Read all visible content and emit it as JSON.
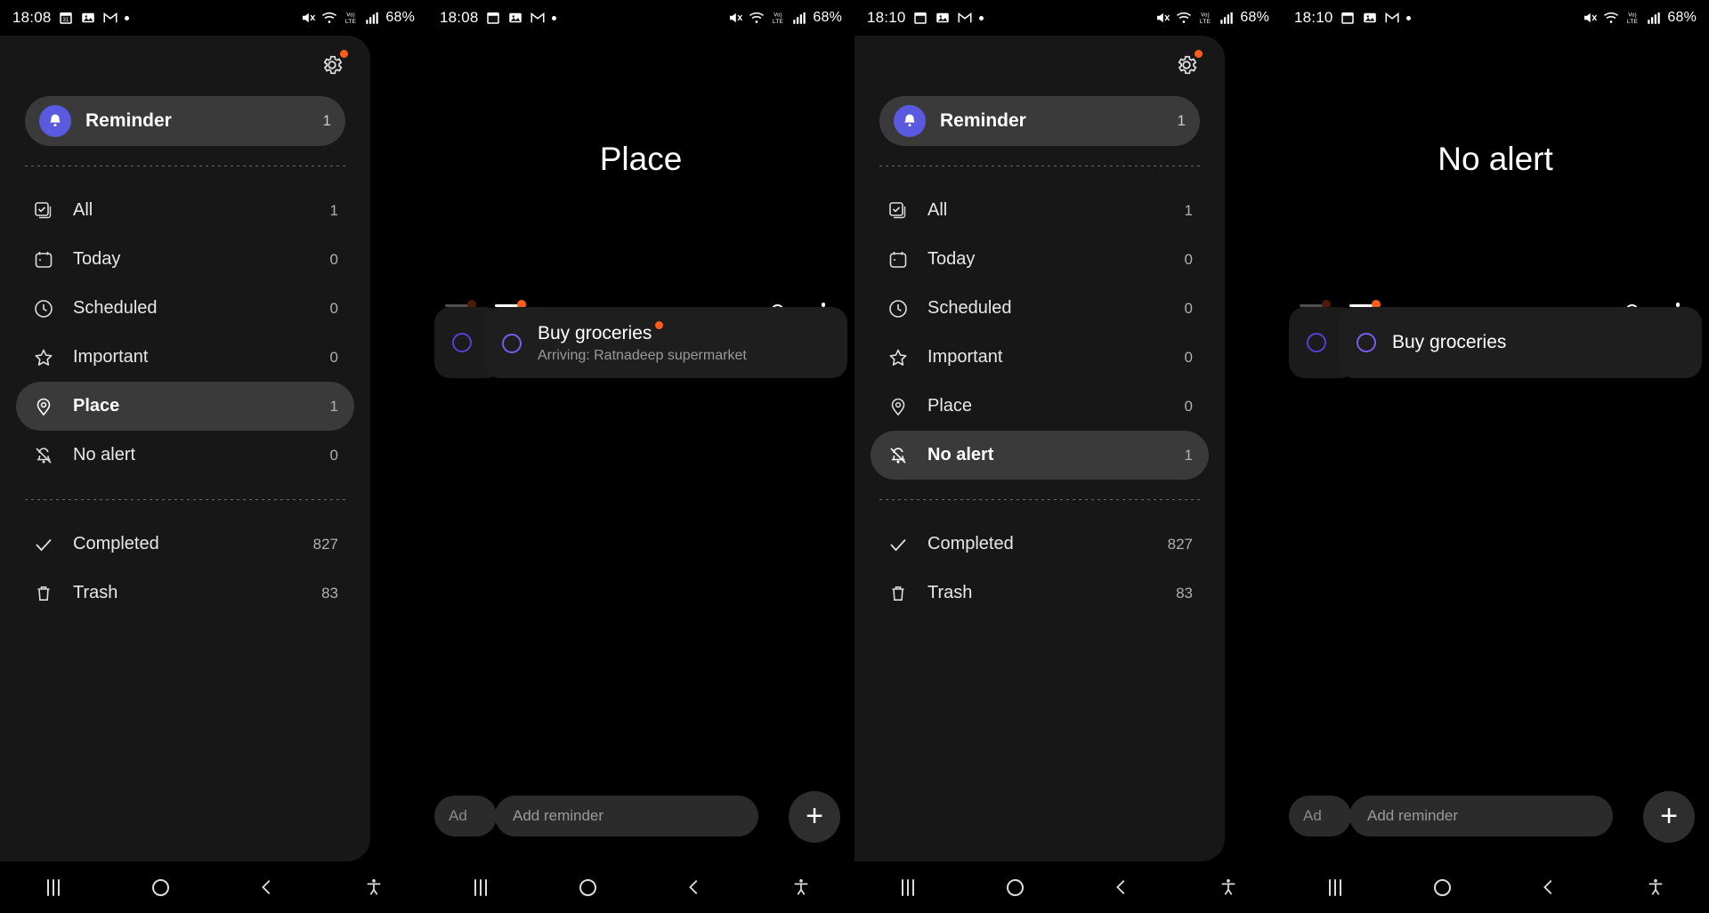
{
  "status_bar": {
    "times": [
      "18:08",
      "18:08",
      "18:10",
      "18:10"
    ],
    "battery": "68%",
    "network": "LTE",
    "icons": [
      "calendar-icon",
      "photos-icon",
      "gmail-icon",
      "notification-dot"
    ],
    "right_icons": [
      "mute-icon",
      "wifi-icon",
      "volte-icon",
      "signal-icon"
    ]
  },
  "drawer": {
    "settings_icon": "gear-icon",
    "account": {
      "icon": "bell-icon",
      "label": "Reminder",
      "count": "1"
    },
    "items": [
      {
        "icon": "all-checkbox-icon",
        "label": "All",
        "count": "1"
      },
      {
        "icon": "calendar-icon",
        "label": "Today",
        "count": "0"
      },
      {
        "icon": "clock-icon",
        "label": "Scheduled",
        "count": "0"
      },
      {
        "icon": "star-icon",
        "label": "Important",
        "count": "0"
      },
      {
        "icon": "location-pin-icon",
        "label": "Place",
        "count": "1"
      },
      {
        "icon": "bell-slash-icon",
        "label": "No alert",
        "count": "0"
      }
    ],
    "items_b": [
      {
        "icon": "all-checkbox-icon",
        "label": "All",
        "count": "1"
      },
      {
        "icon": "calendar-icon",
        "label": "Today",
        "count": "0"
      },
      {
        "icon": "clock-icon",
        "label": "Scheduled",
        "count": "0"
      },
      {
        "icon": "star-icon",
        "label": "Important",
        "count": "0"
      },
      {
        "icon": "location-pin-icon",
        "label": "Place",
        "count": "0"
      },
      {
        "icon": "bell-slash-icon",
        "label": "No alert",
        "count": "1"
      }
    ],
    "footer_items": [
      {
        "icon": "check-icon",
        "label": "Completed",
        "count": "827"
      },
      {
        "icon": "trash-icon",
        "label": "Trash",
        "count": "83"
      }
    ],
    "selected_panel1": "Place",
    "selected_panel3": "No alert"
  },
  "list_place": {
    "title": "Place",
    "menu_icon": "hamburger-icon",
    "search_icon": "search-icon",
    "overflow_icon": "kebab-menu-icon",
    "reminder": {
      "title": "Buy groceries",
      "subtitle": "Arriving: Ratnadeep supermarket",
      "checkbox_icon": "circle-checkbox-icon",
      "has_badge": true
    },
    "add_placeholder": "Add reminder",
    "add_placeholder_short": "Ad",
    "fab_label": "+"
  },
  "list_no_alert": {
    "title": "No alert",
    "menu_icon": "hamburger-icon",
    "search_icon": "search-icon",
    "overflow_icon": "kebab-menu-icon",
    "reminder": {
      "title": "Buy groceries",
      "subtitle": "",
      "checkbox_icon": "circle-checkbox-icon",
      "has_badge": false
    },
    "add_placeholder": "Add reminder",
    "add_placeholder_short": "Ad",
    "fab_label": "+"
  },
  "nav_bar": {
    "recents": "recents-icon",
    "home": "home-icon",
    "back": "back-icon",
    "accessibility": "accessibility-icon"
  },
  "colors": {
    "accent_orange": "#ff5e1a",
    "accent_purple": "#5a5ae0",
    "checkbox_purple": "#7a5cf0",
    "panel_bg": "#171717",
    "selected_bg": "#3a3a3a",
    "card_bg": "#1e1e1e"
  }
}
